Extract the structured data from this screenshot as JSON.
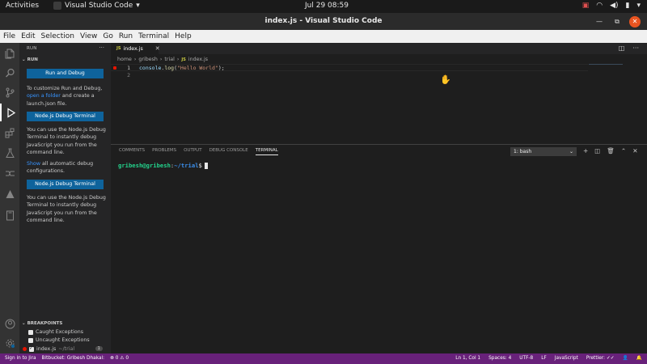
{
  "topbar": {
    "activities": "Activities",
    "app_name": "Visual Studio Code",
    "clock": "Jul 29  08:59"
  },
  "window": {
    "title": "index.js - Visual Studio Code"
  },
  "menu": [
    "File",
    "Edit",
    "Selection",
    "View",
    "Go",
    "Run",
    "Terminal",
    "Help"
  ],
  "sidebar": {
    "title": "RUN",
    "section": "RUN",
    "run_debug_button": "Run and Debug",
    "customize_pre": "To customize Run and Debug,",
    "open_folder_link": "open a folder",
    "customize_post": "and create a launch.json file.",
    "node_terminal_button": "Node.js Debug Terminal",
    "node_terminal_desc": "You can use the Node.js Debug Terminal to instantly debug JavaScript you run from the command line.",
    "show_link": "Show",
    "show_rest": "all automatic debug configurations.",
    "node_terminal_button_2": "Node.js Debug Terminal",
    "node_terminal_desc_2": "You can use the Node.js Debug Terminal to instantly debug JavaScript you run from the command line.",
    "breakpoints": {
      "title": "BREAKPOINTS",
      "items": [
        {
          "label": "Caught Exceptions",
          "checked": false
        },
        {
          "label": "Uncaught Exceptions",
          "checked": false
        },
        {
          "label": "index.js",
          "detail": "~/trial",
          "count": "1",
          "checked": true
        }
      ]
    }
  },
  "editor": {
    "tab": {
      "icon": "JS",
      "label": "index.js"
    },
    "breadcrumb": [
      "home",
      "gribesh",
      "trial",
      "index.js"
    ],
    "breadcrumb_icon": "JS",
    "lines": [
      {
        "number": "1",
        "code": {
          "id": "console",
          "dot": ".",
          "fn": "log",
          "open": "(",
          "str": "\"Hello World\"",
          "close": ");"
        }
      },
      {
        "number": "2"
      }
    ]
  },
  "panel": {
    "tabs": [
      "COMMENTS",
      "PROBLEMS",
      "OUTPUT",
      "DEBUG CONSOLE",
      "TERMINAL"
    ],
    "active_tab": "TERMINAL",
    "terminal_select": "1: bash",
    "terminal": {
      "user": "gribesh@gribesh",
      "sep": ":",
      "path": "~/trial",
      "prompt": "$"
    }
  },
  "statusbar": {
    "left": [
      "Sign in to Jira",
      "Bitbucket: Gribesh Dhakal:",
      "⊗ 0  ⚠ 0"
    ],
    "right": [
      "Ln 1, Col 1",
      "Spaces: 4",
      "UTF-8",
      "LF",
      "JavaScript",
      "Prettier: ✓✓",
      "👤",
      "🔔"
    ]
  },
  "colors": {
    "statusbar": "#68217a",
    "button": "#0e639c",
    "breakpoint": "#e51400"
  }
}
